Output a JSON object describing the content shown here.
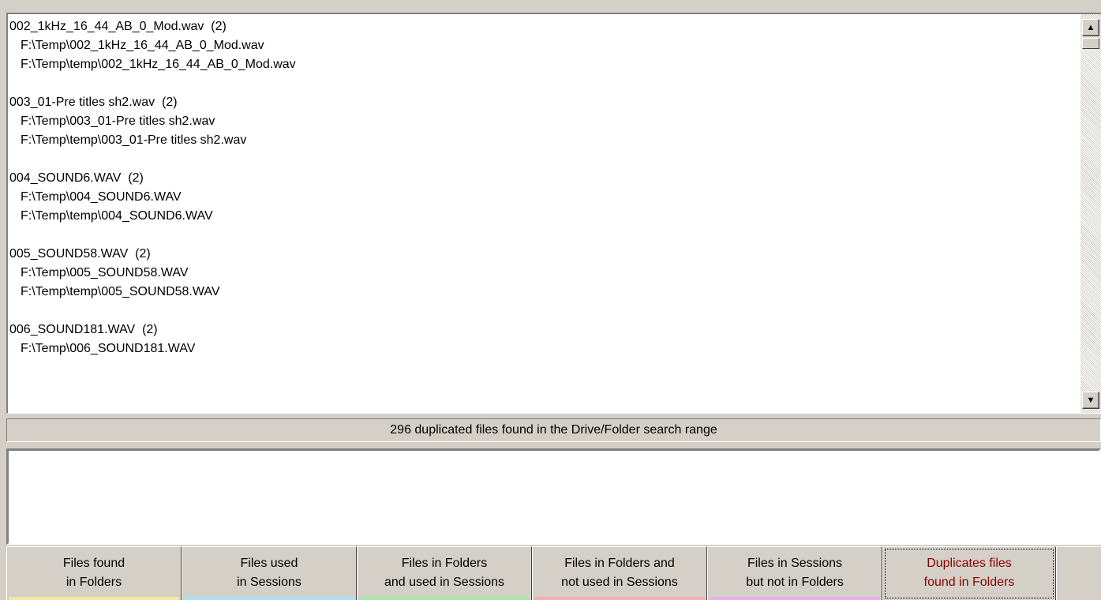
{
  "duplicates_list": {
    "groups": [
      {
        "title": "002_1kHz_16_44_AB_0_Mod.wav  (2)",
        "paths": [
          "F:\\Temp\\002_1kHz_16_44_AB_0_Mod.wav",
          "F:\\Temp\\temp\\002_1kHz_16_44_AB_0_Mod.wav"
        ]
      },
      {
        "title": "003_01-Pre titles sh2.wav  (2)",
        "paths": [
          "F:\\Temp\\003_01-Pre titles sh2.wav",
          "F:\\Temp\\temp\\003_01-Pre titles sh2.wav"
        ]
      },
      {
        "title": "004_SOUND6.WAV  (2)",
        "paths": [
          "F:\\Temp\\004_SOUND6.WAV",
          "F:\\Temp\\temp\\004_SOUND6.WAV"
        ]
      },
      {
        "title": "005_SOUND58.WAV  (2)",
        "paths": [
          "F:\\Temp\\005_SOUND58.WAV",
          "F:\\Temp\\temp\\005_SOUND58.WAV"
        ]
      },
      {
        "title": "006_SOUND181.WAV  (2)",
        "paths": [
          "F:\\Temp\\006_SOUND181.WAV"
        ]
      }
    ]
  },
  "scrollbar": {
    "up_icon": "arrow-up-icon",
    "down_icon": "arrow-down-icon"
  },
  "status": {
    "text": "296 duplicated files found in the Drive/Folder search range"
  },
  "detail": {
    "text": ""
  },
  "tabs": [
    {
      "line1": "Files found",
      "line2": "in Folders",
      "color": "#f2e8a0",
      "active": false
    },
    {
      "line1": "Files used",
      "line2": "in Sessions",
      "color": "#a8e4f0",
      "active": false
    },
    {
      "line1": "Files in Folders",
      "line2": "and used in Sessions",
      "color": "#a8e8a8",
      "active": false
    },
    {
      "line1": "Files in Folders and",
      "line2": "not used in Sessions",
      "color": "#f4b0b0",
      "active": false
    },
    {
      "line1": "Files in Sessions",
      "line2": "but not in Folders",
      "color": "#e8b0e8",
      "active": false
    },
    {
      "line1": "Duplicates files",
      "line2": "found in Folders",
      "color": "#d4d0c8",
      "active": true
    }
  ],
  "colors": {
    "active_tab_text": "#8b0000",
    "face": "#d4d0c8"
  }
}
